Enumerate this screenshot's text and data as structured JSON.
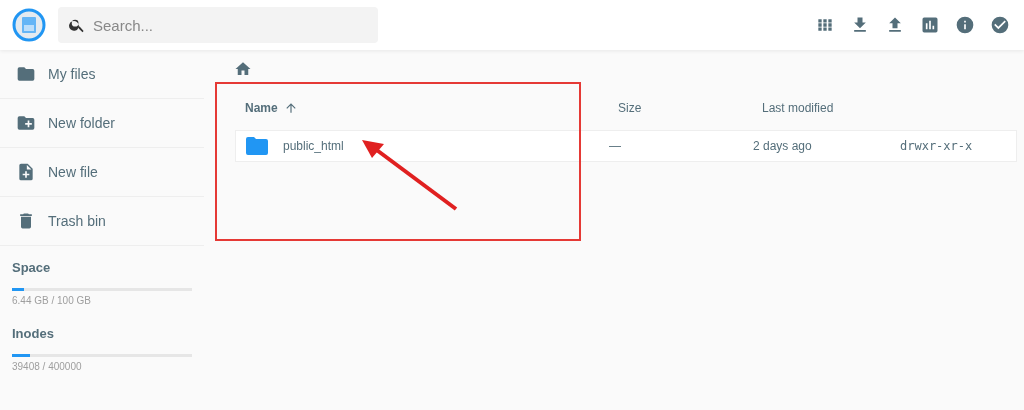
{
  "search": {
    "placeholder": "Search..."
  },
  "sidebar": {
    "items": [
      {
        "label": "My files",
        "kind": "folder"
      },
      {
        "label": "New folder",
        "kind": "new-folder"
      },
      {
        "label": "New file",
        "kind": "new-file"
      },
      {
        "label": "Trash bin",
        "kind": "trash"
      }
    ],
    "usage": [
      {
        "title": "Space",
        "level": 0.0644,
        "reading": "6.44 GB / 100 GB"
      },
      {
        "title": "Inodes",
        "level": 0.0985,
        "reading": "39408 / 400000"
      }
    ]
  },
  "table": {
    "columns": [
      {
        "label": "Name",
        "sorted": true
      },
      {
        "label": "Size",
        "sorted": false
      },
      {
        "label": "Last modified",
        "sorted": false
      }
    ],
    "rows": [
      {
        "name": "public_html",
        "size": "—",
        "modified": "2 days ago",
        "permissions": "drwxr-xr-x"
      }
    ]
  }
}
